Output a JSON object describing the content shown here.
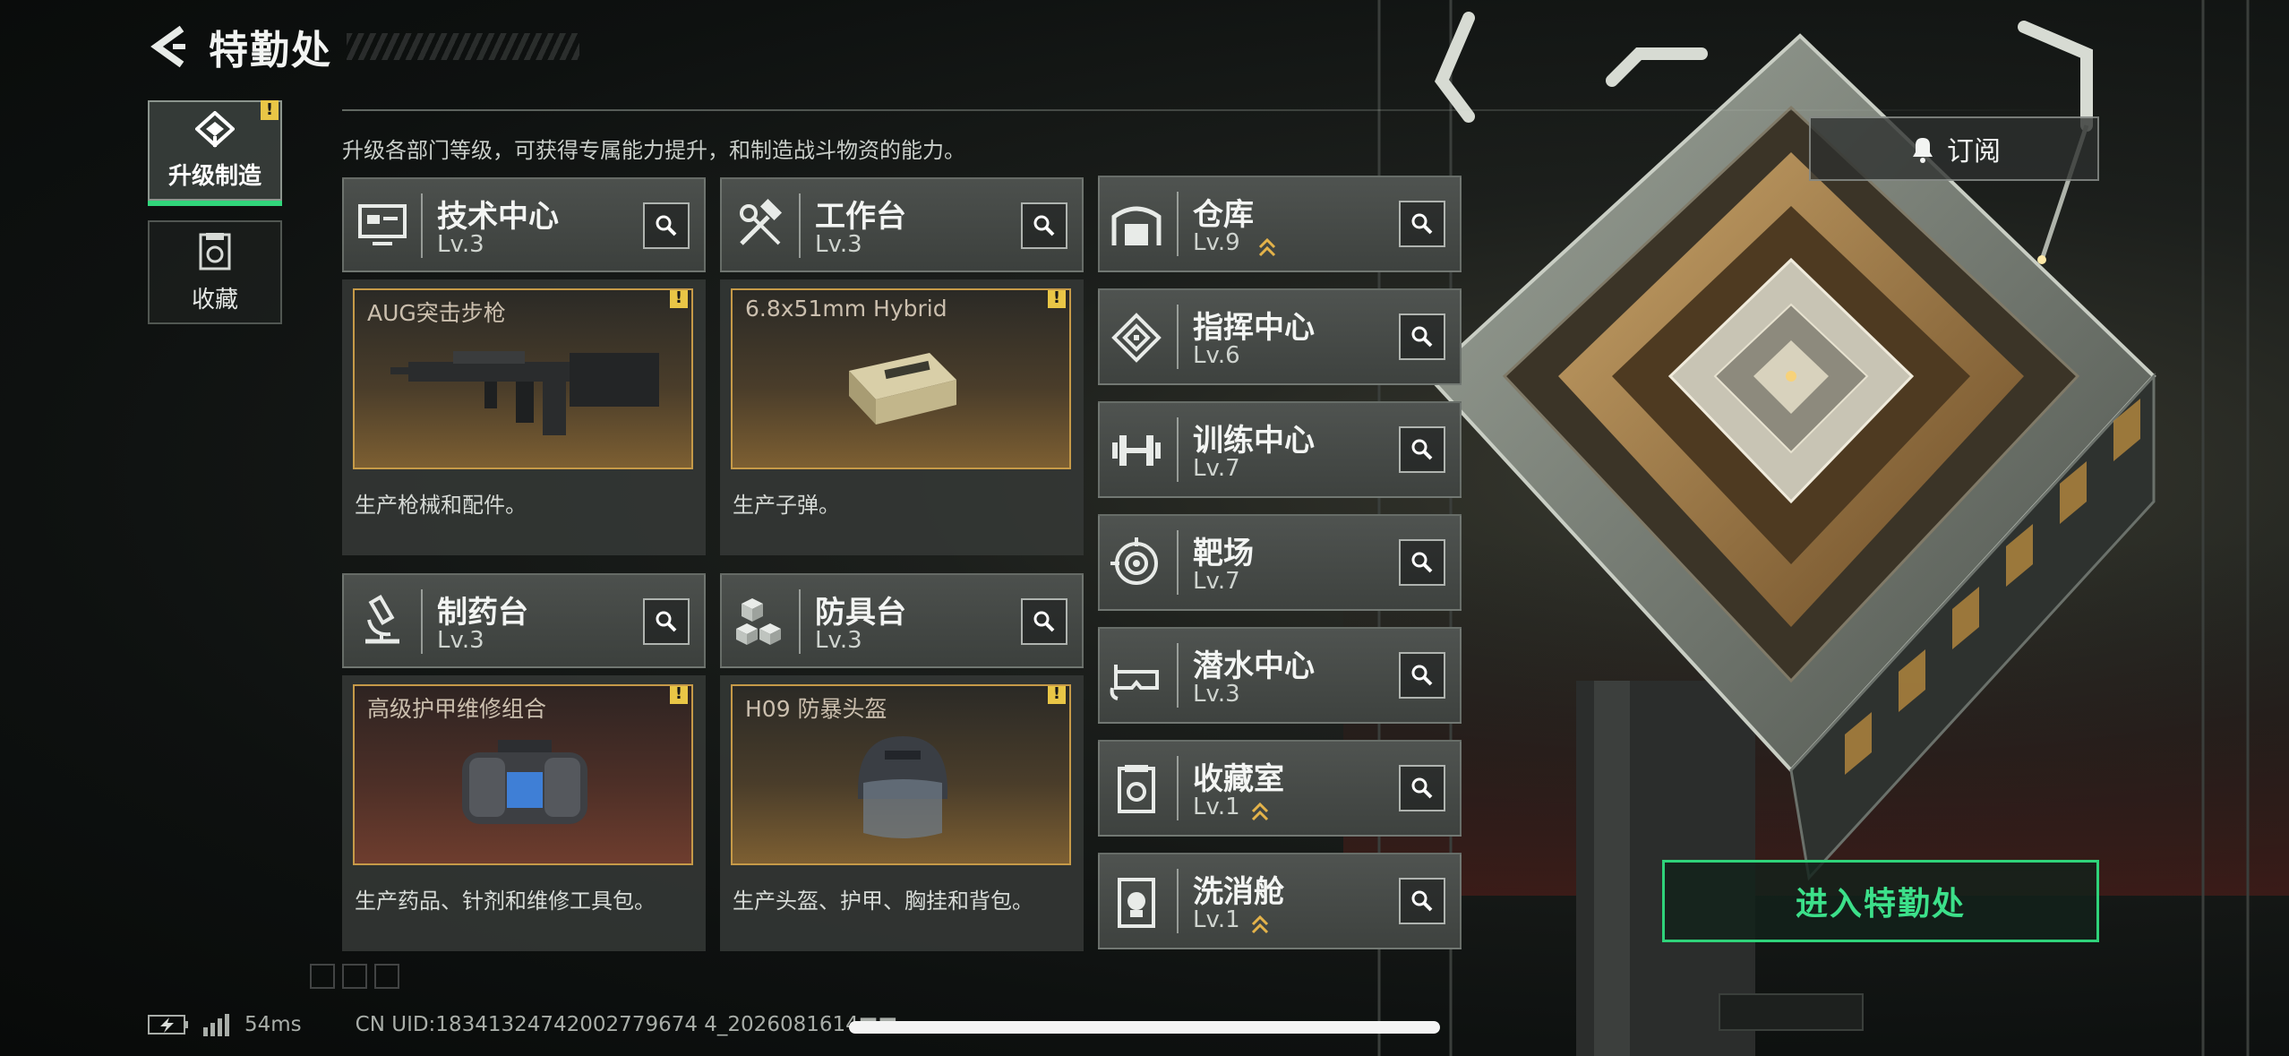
{
  "header": {
    "title": "特勤处"
  },
  "subtitle": "升级各部门等级，可获得专属能力提升，和制造战斗物资的能力。",
  "side_tabs": [
    {
      "label": "升级制造",
      "active": true,
      "icon": "upgrade-icon",
      "alert": "!"
    },
    {
      "label": "收藏",
      "active": false,
      "icon": "collection-icon"
    }
  ],
  "workstations": [
    {
      "name": "技术中心",
      "level": "Lv.3",
      "icon": "computer-icon",
      "product": "AUG突击步枪",
      "product_icon": "rifle-icon",
      "alert": "!",
      "desc": "生产枪械和配件。"
    },
    {
      "name": "工作台",
      "level": "Lv.3",
      "icon": "tools-icon",
      "product": "6.8x51mm Hybrid",
      "product_icon": "ammo-box-icon",
      "alert": "!",
      "desc": "生产子弹。"
    },
    {
      "name": "制药台",
      "level": "Lv.3",
      "icon": "microscope-icon",
      "product": "高级护甲维修组合",
      "product_icon": "repair-kit-icon",
      "alert": "!",
      "desc": "生产药品、针剂和维修工具包。"
    },
    {
      "name": "防具台",
      "level": "Lv.3",
      "icon": "armor-blocks-icon",
      "product": "H09 防暴头盔",
      "product_icon": "helmet-icon",
      "alert": "!",
      "desc": "生产头盔、护甲、胸挂和背包。"
    }
  ],
  "rooms": [
    {
      "name": "仓库",
      "level": "Lv.9",
      "icon": "warehouse-icon",
      "upgradable": true
    },
    {
      "name": "指挥中心",
      "level": "Lv.6",
      "icon": "command-icon",
      "upgradable": false
    },
    {
      "name": "训练中心",
      "level": "Lv.7",
      "icon": "dumbbell-icon",
      "upgradable": false
    },
    {
      "name": "靶场",
      "level": "Lv.7",
      "icon": "target-icon",
      "upgradable": false
    },
    {
      "name": "潜水中心",
      "level": "Lv.3",
      "icon": "diving-mask-icon",
      "upgradable": false
    },
    {
      "name": "收藏室",
      "level": "Lv.1",
      "icon": "collection-room-icon",
      "upgradable": true
    },
    {
      "name": "洗消舱",
      "level": "Lv.1",
      "icon": "decontamination-icon",
      "upgradable": true
    }
  ],
  "buttons": {
    "subscribe": "订阅",
    "enter": "进入特勤处"
  },
  "status_bar": {
    "ping": "54ms",
    "uid": "CN UID:18341324742002779674 4_2026081614■■"
  },
  "colors": {
    "accent_green": "#2fd37a",
    "alert_yellow": "#e9c646",
    "product_border": "#c69a48",
    "upgrade_arrow": "#e4b34a"
  }
}
